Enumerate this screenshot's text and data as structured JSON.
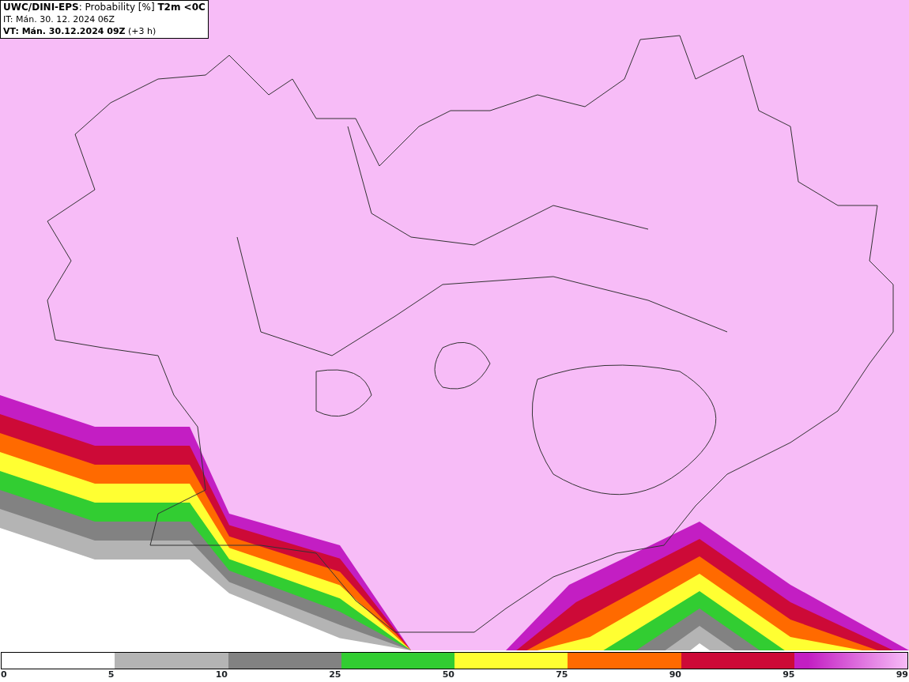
{
  "header": {
    "title": "**UWC/DINI-EPS**: Probability [%] **T2m <0C**",
    "init_time": "IT: Mán. 30. 12. 2024 06Z",
    "valid_time": "**VT: Mán. 30.12.2024 09Z** (+3 h)"
  },
  "legend": {
    "segments": [
      {
        "color": "#ffffff"
      },
      {
        "color": "#b4b4b4"
      },
      {
        "color": "#828282"
      },
      {
        "color": "#32cd32"
      },
      {
        "color": "#ffff32"
      },
      {
        "color": "#ff6a00"
      },
      {
        "color": "#cd0a37"
      },
      {
        "color": "#c31ec3"
      }
    ],
    "ticks": [
      "0",
      "5",
      "10",
      "25",
      "50",
      "75",
      "90",
      "95",
      "99"
    ]
  }
}
